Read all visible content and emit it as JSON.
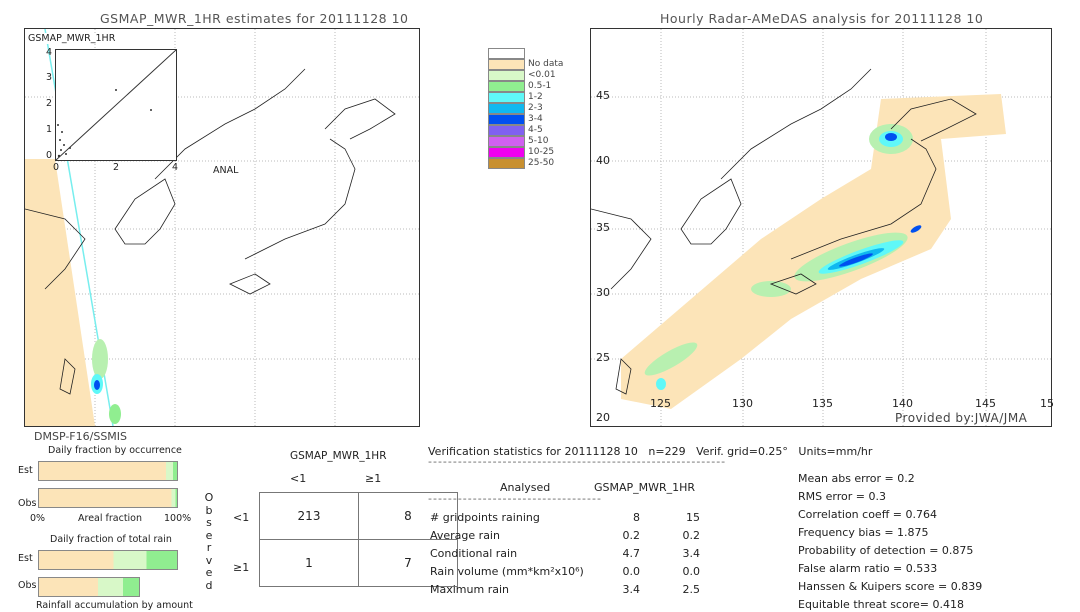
{
  "left_map": {
    "title": "GSMAP_MWR_1HR estimates for 20111128 10",
    "inset_label": "GSMAP_MWR_1HR",
    "inset_x_ticks": [
      "0",
      "1",
      "2",
      "3",
      "4"
    ],
    "inset_y_ticks": [
      "0",
      "1",
      "2",
      "3",
      "4"
    ],
    "inset_x_label": "ANAL",
    "satellite": "DMSP-F16/SSMIS"
  },
  "right_map": {
    "title": "Hourly Radar-AMeDAS analysis for 20111128 10",
    "lat_labels": [
      "45",
      "40",
      "35",
      "30",
      "25",
      "20"
    ],
    "lon_labels": [
      "125",
      "130",
      "135",
      "140",
      "145",
      "15"
    ],
    "credit": "Provided by:JWA/JMA"
  },
  "legend": {
    "items": [
      {
        "label": "",
        "color": "#ffffff"
      },
      {
        "label": "No data",
        "color": "#fce4b8"
      },
      {
        "label": "<0.01",
        "color": "#d8f8c8"
      },
      {
        "label": "0.5-1",
        "color": "#90ee90"
      },
      {
        "label": "1-2",
        "color": "#5ff8f8"
      },
      {
        "label": "2-3",
        "color": "#10b8f0"
      },
      {
        "label": "3-4",
        "color": "#0050f0"
      },
      {
        "label": "4-5",
        "color": "#8060f0"
      },
      {
        "label": "5-10",
        "color": "#d060f0"
      },
      {
        "label": "10-25",
        "color": "#f000f0"
      },
      {
        "label": "25-50",
        "color": "#c89030"
      }
    ]
  },
  "fractions": {
    "occurrence_title": "Daily fraction by occurrence",
    "est_label": "Est",
    "obs_label": "Obs",
    "axis_left": "0%",
    "axis_mid": "Areal fraction",
    "axis_right": "100%",
    "total_rain_title": "Daily fraction of total rain",
    "accumulation_label": "Rainfall accumulation by amount"
  },
  "contingency": {
    "title": "GSMAP_MWR_1HR",
    "col_headers": [
      "<1",
      "≥1"
    ],
    "row_headers": [
      "<1",
      "≥1"
    ],
    "observed_label": [
      "O",
      "b",
      "s",
      "e",
      "r",
      "v",
      "e",
      "d"
    ],
    "cells": [
      [
        "213",
        "8"
      ],
      [
        "1",
        "7"
      ]
    ]
  },
  "stats": {
    "header": "Verification statistics for 20111128 10   n=229   Verif. grid=0.25°   Units=mm/hr",
    "dashes": "------------------------------------------------------------",
    "col_analysed": "Analysed",
    "col_gsmap": "GSMAP_MWR_1HR",
    "dashes2": "-----------------------------------",
    "rows": [
      {
        "label": "# gridpoints raining",
        "a": "8",
        "b": "15"
      },
      {
        "label": "Average rain",
        "a": "0.2",
        "b": "0.2"
      },
      {
        "label": "Conditional rain",
        "a": "4.7",
        "b": "3.4"
      },
      {
        "label": "Rain volume (mm*km²x10⁶)",
        "a": "0.0",
        "b": "0.0"
      },
      {
        "label": "Maximum rain",
        "a": "3.4",
        "b": "2.5"
      }
    ],
    "scores": [
      "Mean abs error = 0.2",
      "RMS error = 0.3",
      "Correlation coeff = 0.764",
      "Frequency bias = 1.875",
      "Probability of detection = 0.875",
      "False alarm ratio = 0.533",
      "Hanssen & Kuipers score = 0.839",
      "Equitable threat score= 0.418"
    ]
  }
}
